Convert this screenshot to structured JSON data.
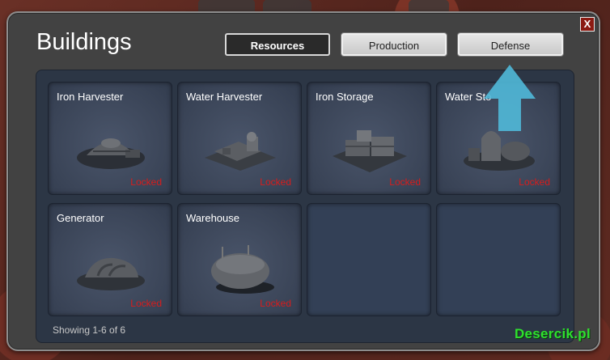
{
  "dialog": {
    "title": "Buildings",
    "close_label": "X",
    "tabs": [
      {
        "label": "Resources",
        "active": true
      },
      {
        "label": "Production",
        "active": false
      },
      {
        "label": "Defense",
        "active": false
      }
    ],
    "footer": "Showing 1-6 of 6"
  },
  "buildings": [
    {
      "name": "Iron Harvester",
      "status": "Locked",
      "icon": "dome-harvester-icon"
    },
    {
      "name": "Water Harvester",
      "status": "Locked",
      "icon": "platform-harvester-icon"
    },
    {
      "name": "Iron Storage",
      "status": "Locked",
      "icon": "storage-complex-icon"
    },
    {
      "name": "Water Sto",
      "status": "Locked",
      "icon": "tank-storage-icon"
    },
    {
      "name": "Generator",
      "status": "Locked",
      "icon": "generator-icon"
    },
    {
      "name": "Warehouse",
      "status": "Locked",
      "icon": "warehouse-icon"
    }
  ],
  "watermark": "Desercik.pl",
  "colors": {
    "locked": "#d81c1c",
    "panel": "#2c3645",
    "pointer": "#4fb6d6",
    "watermark": "#2fe02f"
  }
}
